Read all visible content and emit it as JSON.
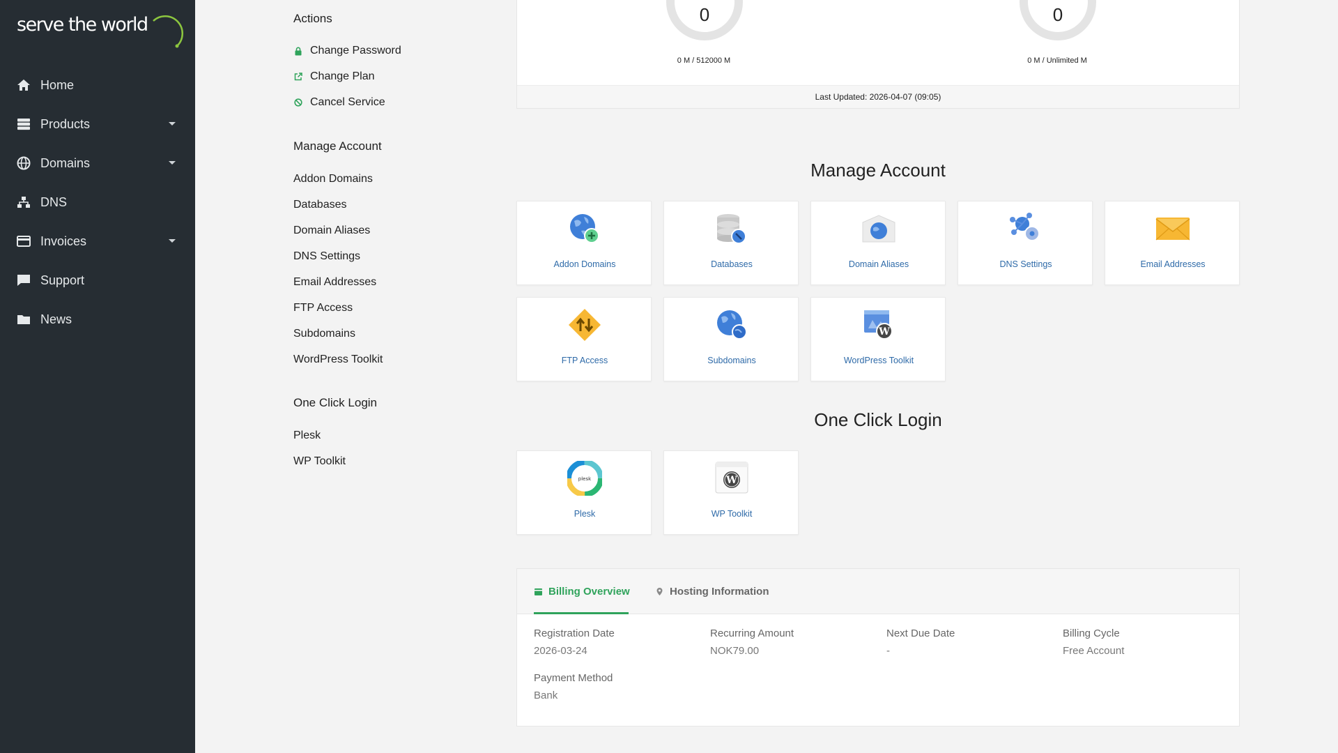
{
  "brand": {
    "logo_text": "serve the world"
  },
  "sidebar": {
    "items": [
      {
        "label": "Home",
        "icon": "home-icon",
        "has_caret": false
      },
      {
        "label": "Products",
        "icon": "server-icon",
        "has_caret": true
      },
      {
        "label": "Domains",
        "icon": "globe-icon",
        "has_caret": true
      },
      {
        "label": "DNS",
        "icon": "network-icon",
        "has_caret": false
      },
      {
        "label": "Invoices",
        "icon": "credit-card-icon",
        "has_caret": true
      },
      {
        "label": "Support",
        "icon": "comment-icon",
        "has_caret": false
      },
      {
        "label": "News",
        "icon": "folder-icon",
        "has_caret": false
      }
    ]
  },
  "left_menu": {
    "actions_title": "Actions",
    "actions": [
      {
        "label": "Change Password",
        "icon": "lock-icon"
      },
      {
        "label": "Change Plan",
        "icon": "external-link-icon"
      },
      {
        "label": "Cancel Service",
        "icon": "ban-icon"
      }
    ],
    "manage_title": "Manage Account",
    "manage": [
      "Addon Domains",
      "Databases",
      "Domain Aliases",
      "DNS Settings",
      "Email Addresses",
      "FTP Access",
      "Subdomains",
      "WordPress Toolkit"
    ],
    "login_title": "One Click Login",
    "login": [
      "Plesk",
      "WP Toolkit"
    ]
  },
  "usage": {
    "disk": {
      "value": "0",
      "caption": "0 M / 512000 M"
    },
    "bandwidth": {
      "value": "0",
      "caption": "0 M / Unlimited M"
    },
    "last_updated": "Last Updated: 2026-04-07 (09:05)"
  },
  "manage_section": {
    "title": "Manage Account",
    "tiles": [
      {
        "label": "Addon Domains",
        "icon": "globe-plus-icon"
      },
      {
        "label": "Databases",
        "icon": "database-icon"
      },
      {
        "label": "Domain Aliases",
        "icon": "domain-alias-icon"
      },
      {
        "label": "DNS Settings",
        "icon": "dns-settings-icon"
      },
      {
        "label": "Email Addresses",
        "icon": "envelope-icon"
      },
      {
        "label": "FTP Access",
        "icon": "ftp-icon"
      },
      {
        "label": "Subdomains",
        "icon": "subdomain-icon"
      },
      {
        "label": "WordPress Toolkit",
        "icon": "wordpress-toolkit-icon"
      }
    ]
  },
  "login_section": {
    "title": "One Click Login",
    "tiles": [
      {
        "label": "Plesk",
        "icon": "plesk-icon",
        "icon_text": "plesk"
      },
      {
        "label": "WP Toolkit",
        "icon": "wordpress-icon"
      }
    ]
  },
  "billing": {
    "tabs": [
      {
        "label": "Billing Overview",
        "active": true
      },
      {
        "label": "Hosting Information",
        "active": false
      }
    ],
    "fields": [
      {
        "label": "Registration Date",
        "value": "2026-03-24"
      },
      {
        "label": "Recurring Amount",
        "value": "NOK79.00"
      },
      {
        "label": "Next Due Date",
        "value": "-"
      },
      {
        "label": "Billing Cycle",
        "value": "Free Account"
      },
      {
        "label": "Payment Method",
        "value": "Bank"
      }
    ]
  },
  "colors": {
    "sidebar": "#262d33",
    "accent_green": "#2fa35b",
    "link_blue": "#2e6aa8"
  }
}
